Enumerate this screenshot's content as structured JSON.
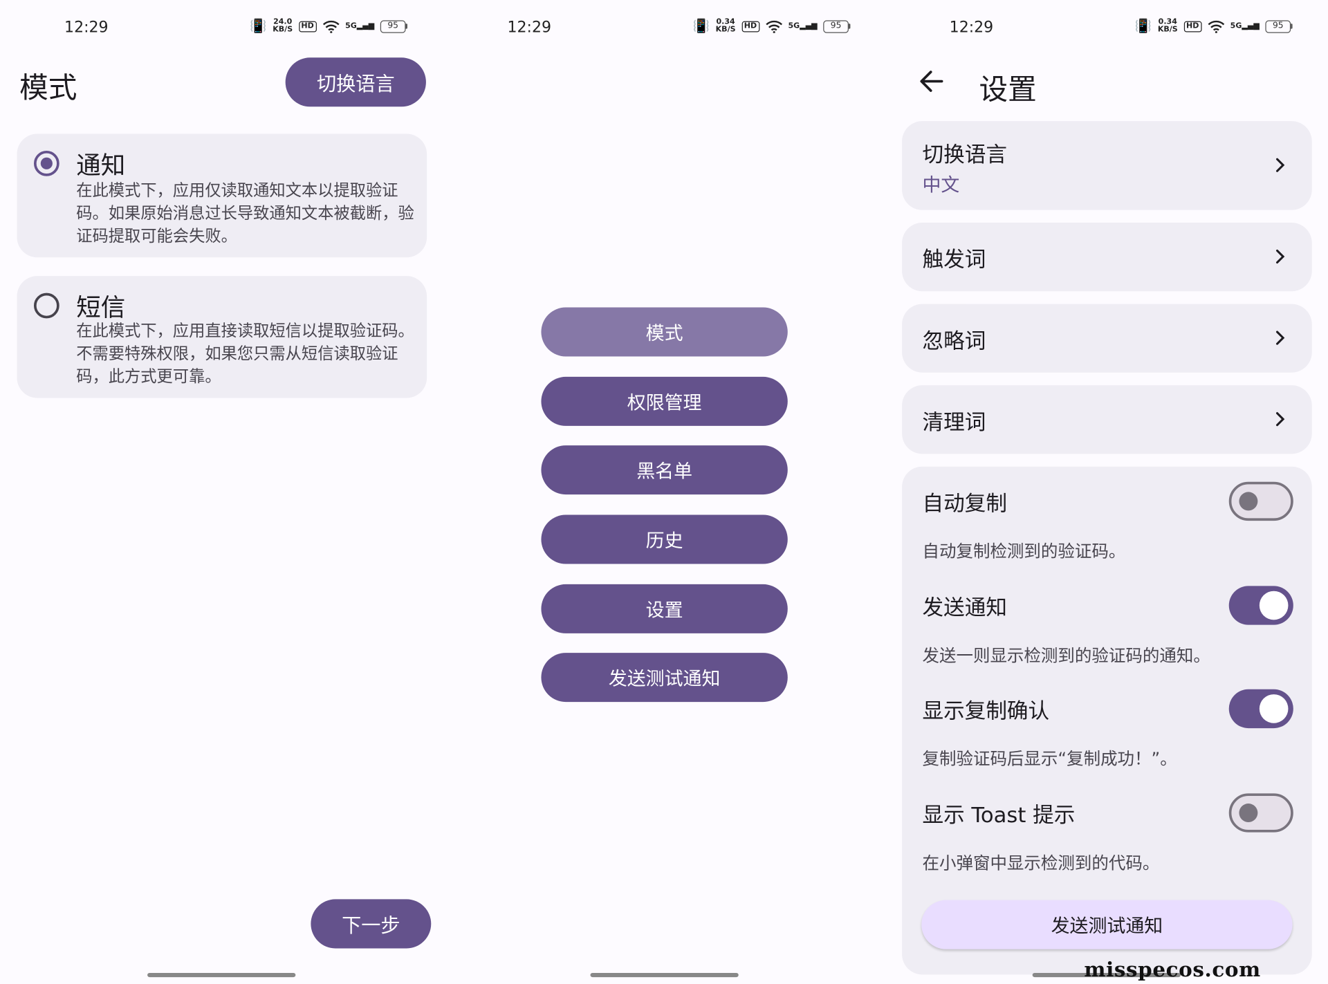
{
  "status_bar": [
    {
      "time": "12:29",
      "net_speed": "24.0",
      "speed_unit": "KB/S",
      "hd": "HD",
      "signal": "5G",
      "battery": "95"
    },
    {
      "time": "12:29",
      "net_speed": "0.34",
      "speed_unit": "KB/S",
      "hd": "HD",
      "signal": "5G",
      "battery": "95"
    },
    {
      "time": "12:29",
      "net_speed": "0.34",
      "speed_unit": "KB/S",
      "hd": "HD",
      "signal": "5G",
      "battery": "95"
    }
  ],
  "mode_screen": {
    "title": "模式",
    "switch_language": "切换语言",
    "options": [
      {
        "title": "通知",
        "desc": "在此模式下，应用仅读取通知文本以提取验证码。如果原始消息过长导致通知文本被截断，验证码提取可能会失败。",
        "selected": true
      },
      {
        "title": "短信",
        "desc": "在此模式下，应用直接读取短信以提取验证码。不需要特殊权限，如果您只需从短信读取验证码，此方式更可靠。",
        "selected": false
      }
    ],
    "next": "下一步"
  },
  "menu_screen": {
    "buttons": [
      "模式",
      "权限管理",
      "黑名单",
      "历史",
      "设置",
      "发送测试通知"
    ]
  },
  "settings_screen": {
    "title": "设置",
    "language": {
      "label": "切换语言",
      "value": "中文"
    },
    "nav_items": [
      "触发词",
      "忽略词",
      "清理词"
    ],
    "toggles": [
      {
        "title": "自动复制",
        "desc": "自动复制检测到的验证码。",
        "on": false
      },
      {
        "title": "发送通知",
        "desc": "发送一则显示检测到的验证码的通知。",
        "on": true
      },
      {
        "title": "显示复制确认",
        "desc": "复制验证码后显示“复制成功！”。",
        "on": true
      },
      {
        "title": "显示 Toast 提示",
        "desc": "在小弹窗中显示检测到的代码。",
        "on": false
      }
    ],
    "test_button": "发送测试通知"
  },
  "watermark": "misspecos.com",
  "colors": {
    "accent": "#64528c",
    "accent_light": "#8678a7",
    "card": "#efedf4",
    "tonal_button": "#e9ddff"
  }
}
